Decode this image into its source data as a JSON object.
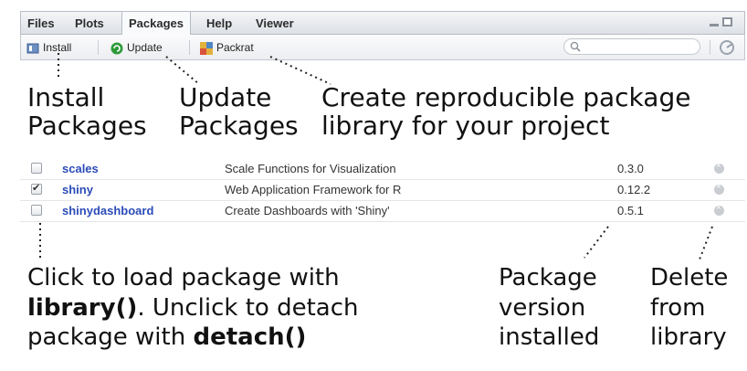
{
  "tabs": [
    "Files",
    "Plots",
    "Packages",
    "Help",
    "Viewer"
  ],
  "toolbar": {
    "install_label": "Install",
    "update_label": "Update",
    "packrat_label": "Packrat",
    "search_placeholder": ""
  },
  "annotations": {
    "install": [
      "Install",
      "Packages"
    ],
    "update": [
      "Update",
      "Packages"
    ],
    "packrat": [
      "Create reproducible package",
      "library for your project"
    ],
    "load_line1_pre": "Click to load package with",
    "load_line2_bold": "library()",
    "load_line2_rest": ". Unclick to detach",
    "load_line3_pre": "package with ",
    "load_line3_bold": "detach()",
    "version": [
      "Package",
      "version",
      "installed"
    ],
    "delete": [
      "Delete",
      "from",
      "library"
    ]
  },
  "packages": [
    {
      "name": "scales",
      "description": "Scale Functions for Visualization",
      "version": "0.3.0",
      "loaded": false
    },
    {
      "name": "shiny",
      "description": "Web Application Framework for R",
      "version": "0.12.2",
      "loaded": true
    },
    {
      "name": "shinydashboard",
      "description": "Create Dashboards with 'Shiny'",
      "version": "0.5.1",
      "loaded": false
    }
  ],
  "colors": {
    "package_link": "#2b4bb8",
    "update_icon": "#2e9b3a"
  }
}
